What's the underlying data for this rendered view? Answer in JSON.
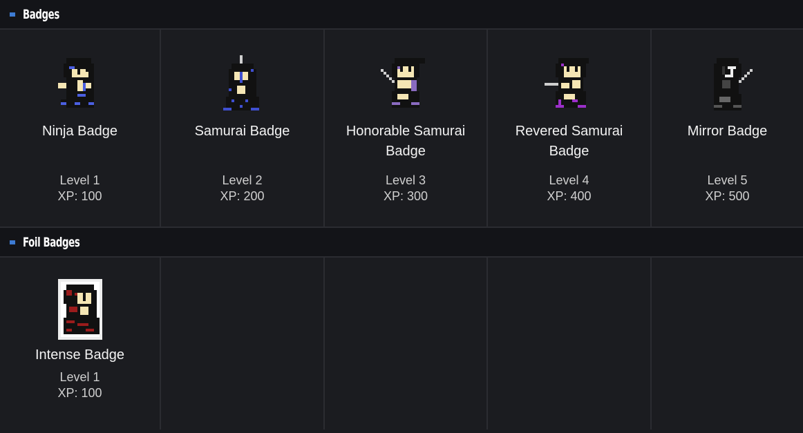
{
  "sections": [
    {
      "title": "Badges",
      "badges": [
        {
          "name": "Ninja Badge",
          "level": "Level 1",
          "xp": "XP: 100",
          "icon": "ninja-icon",
          "accent": "#4b5fe0"
        },
        {
          "name": "Samurai Badge",
          "level": "Level 2",
          "xp": "XP: 200",
          "icon": "samurai-icon",
          "accent": "#3f4fd0"
        },
        {
          "name": "Honorable Samurai Badge",
          "level": "Level 3",
          "xp": "XP: 300",
          "icon": "honorable-samurai-icon",
          "accent": "#8a6bc0"
        },
        {
          "name": "Revered Samurai Badge",
          "level": "Level 4",
          "xp": "XP: 400",
          "icon": "revered-samurai-icon",
          "accent": "#9b2fc9"
        },
        {
          "name": "Mirror Badge",
          "level": "Level 5",
          "xp": "XP: 500",
          "icon": "mirror-icon",
          "accent": "#777777"
        }
      ]
    },
    {
      "title": "Foil Badges",
      "badges": [
        {
          "name": "Intense Badge",
          "level": "Level 1",
          "xp": "XP: 100",
          "icon": "intense-icon",
          "accent": "#9a1c1c"
        }
      ]
    }
  ]
}
